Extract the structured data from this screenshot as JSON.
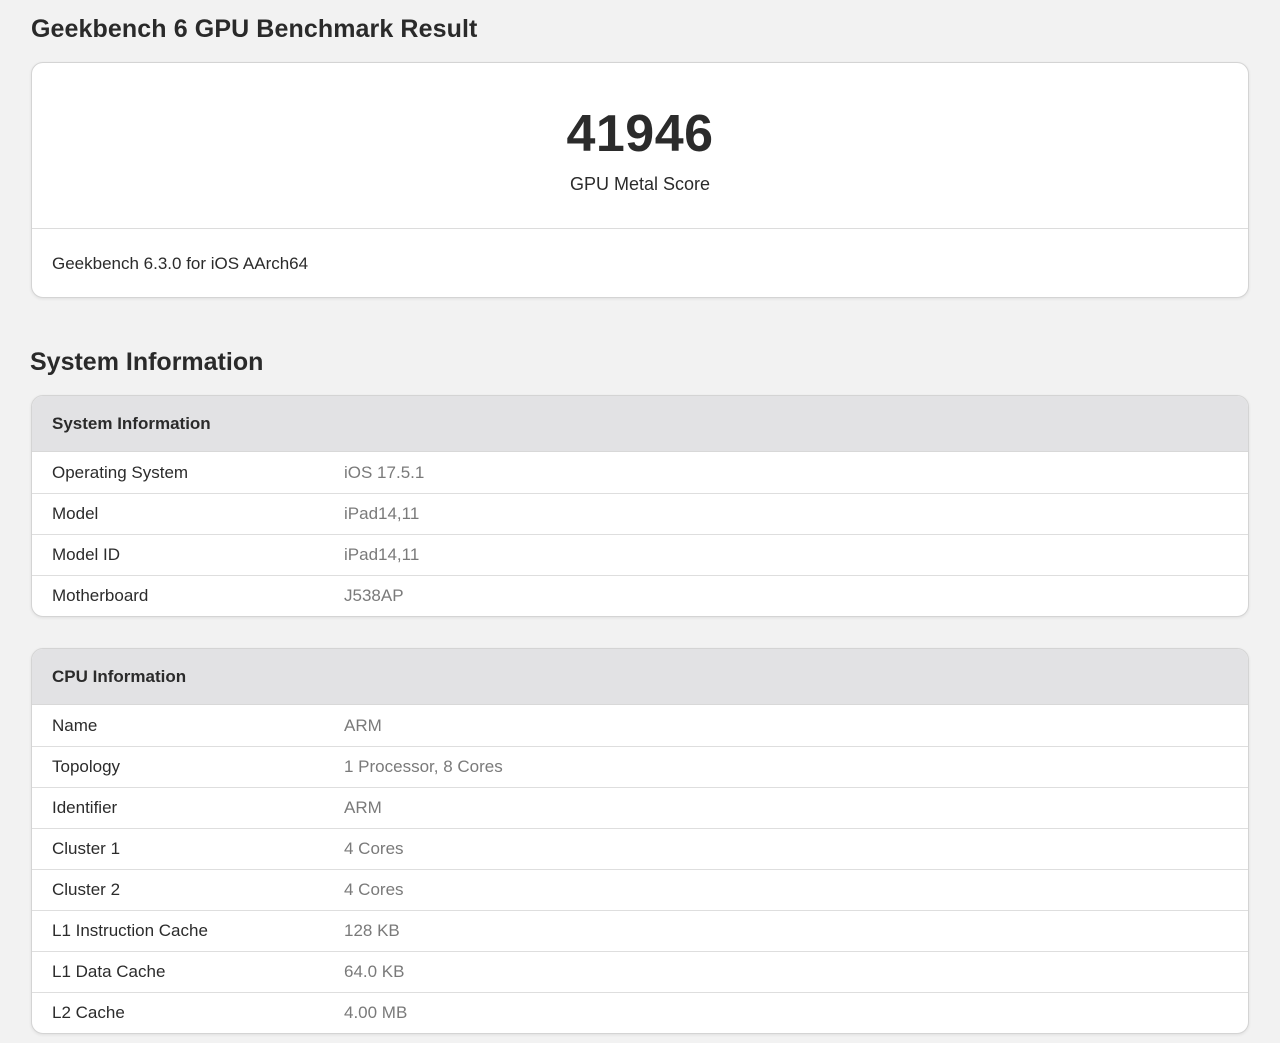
{
  "page_title": "Geekbench 6 GPU Benchmark Result",
  "score": {
    "value": "41946",
    "label": "GPU Metal Score",
    "version": "Geekbench 6.3.0 for iOS AArch64"
  },
  "section_title": "System Information",
  "system_info": {
    "header": "System Information",
    "rows": [
      {
        "key": "Operating System",
        "value": "iOS 17.5.1"
      },
      {
        "key": "Model",
        "value": "iPad14,11"
      },
      {
        "key": "Model ID",
        "value": "iPad14,11"
      },
      {
        "key": "Motherboard",
        "value": "J538AP"
      }
    ]
  },
  "cpu_info": {
    "header": "CPU Information",
    "rows": [
      {
        "key": "Name",
        "value": "ARM"
      },
      {
        "key": "Topology",
        "value": "1 Processor, 8 Cores"
      },
      {
        "key": "Identifier",
        "value": "ARM"
      },
      {
        "key": "Cluster 1",
        "value": "4 Cores"
      },
      {
        "key": "Cluster 2",
        "value": "4 Cores"
      },
      {
        "key": "L1 Instruction Cache",
        "value": "128 KB"
      },
      {
        "key": "L1 Data Cache",
        "value": "64.0 KB"
      },
      {
        "key": "L2 Cache",
        "value": "4.00 MB"
      }
    ]
  }
}
